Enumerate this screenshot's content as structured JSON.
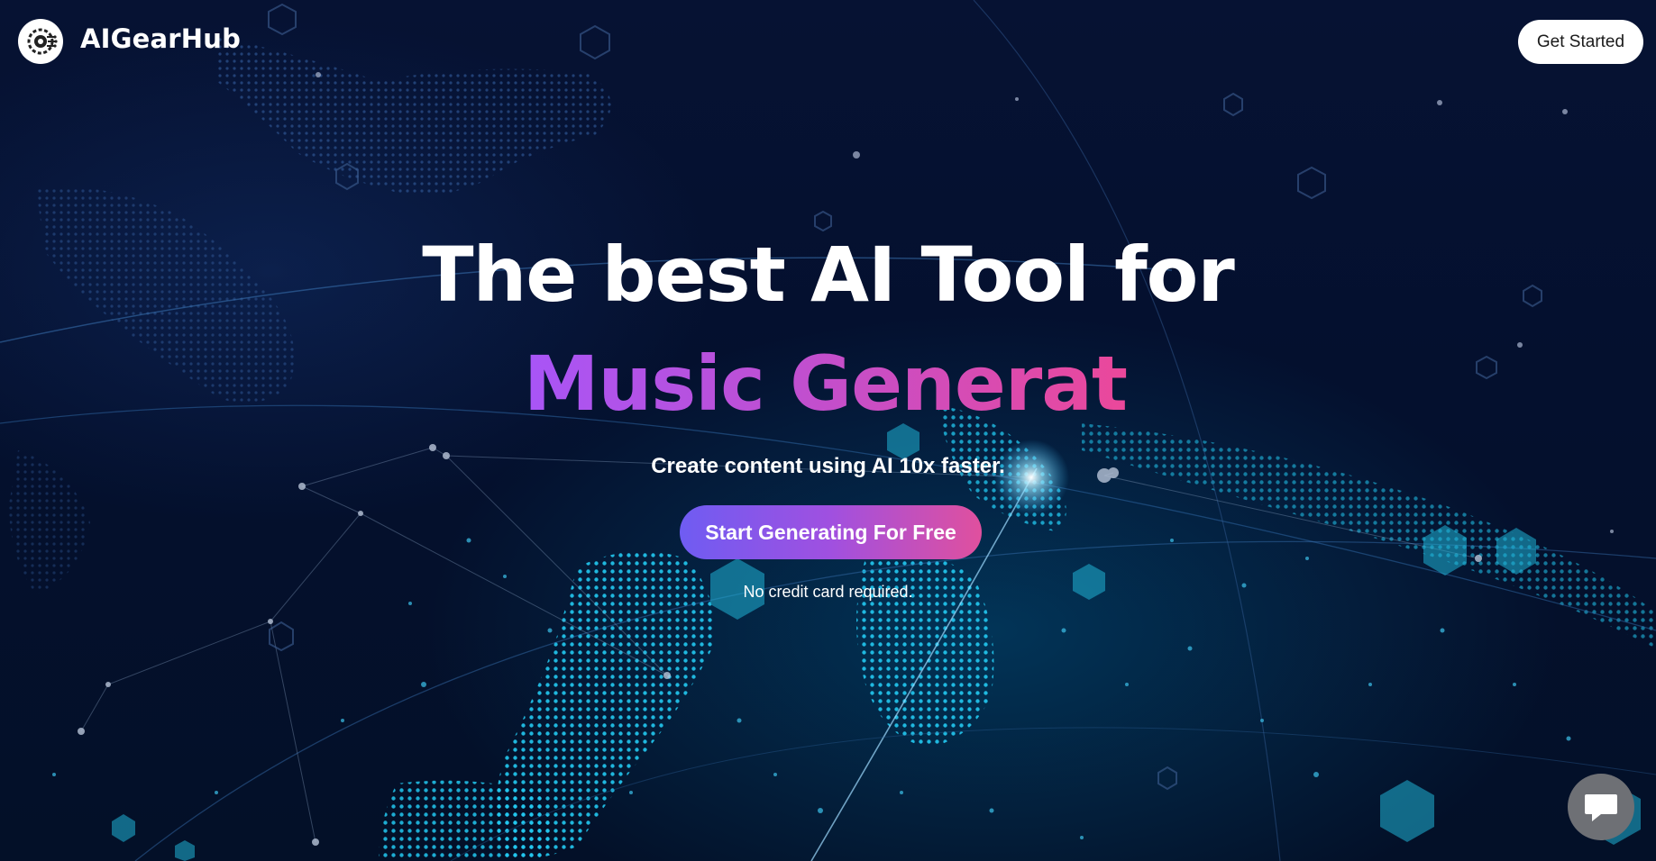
{
  "header": {
    "logo_icon": "gear-circuit-icon",
    "brand": "AIGearHub",
    "get_started_label": "Get Started"
  },
  "hero": {
    "title_line1": "The best AI Tool for",
    "title_line2": "Music Generat",
    "subtitle": "Create content using AI 10x faster.",
    "cta_label": "Start Generating For Free",
    "note": "No credit card required."
  },
  "chat_widget": {
    "icon": "chat-bubble-icon"
  },
  "colors": {
    "background": "#061233",
    "accent_start": "#6f5cf2",
    "accent_end": "#e0509e",
    "gradient_text_start": "#a855f7",
    "gradient_text_end": "#ec4899"
  }
}
